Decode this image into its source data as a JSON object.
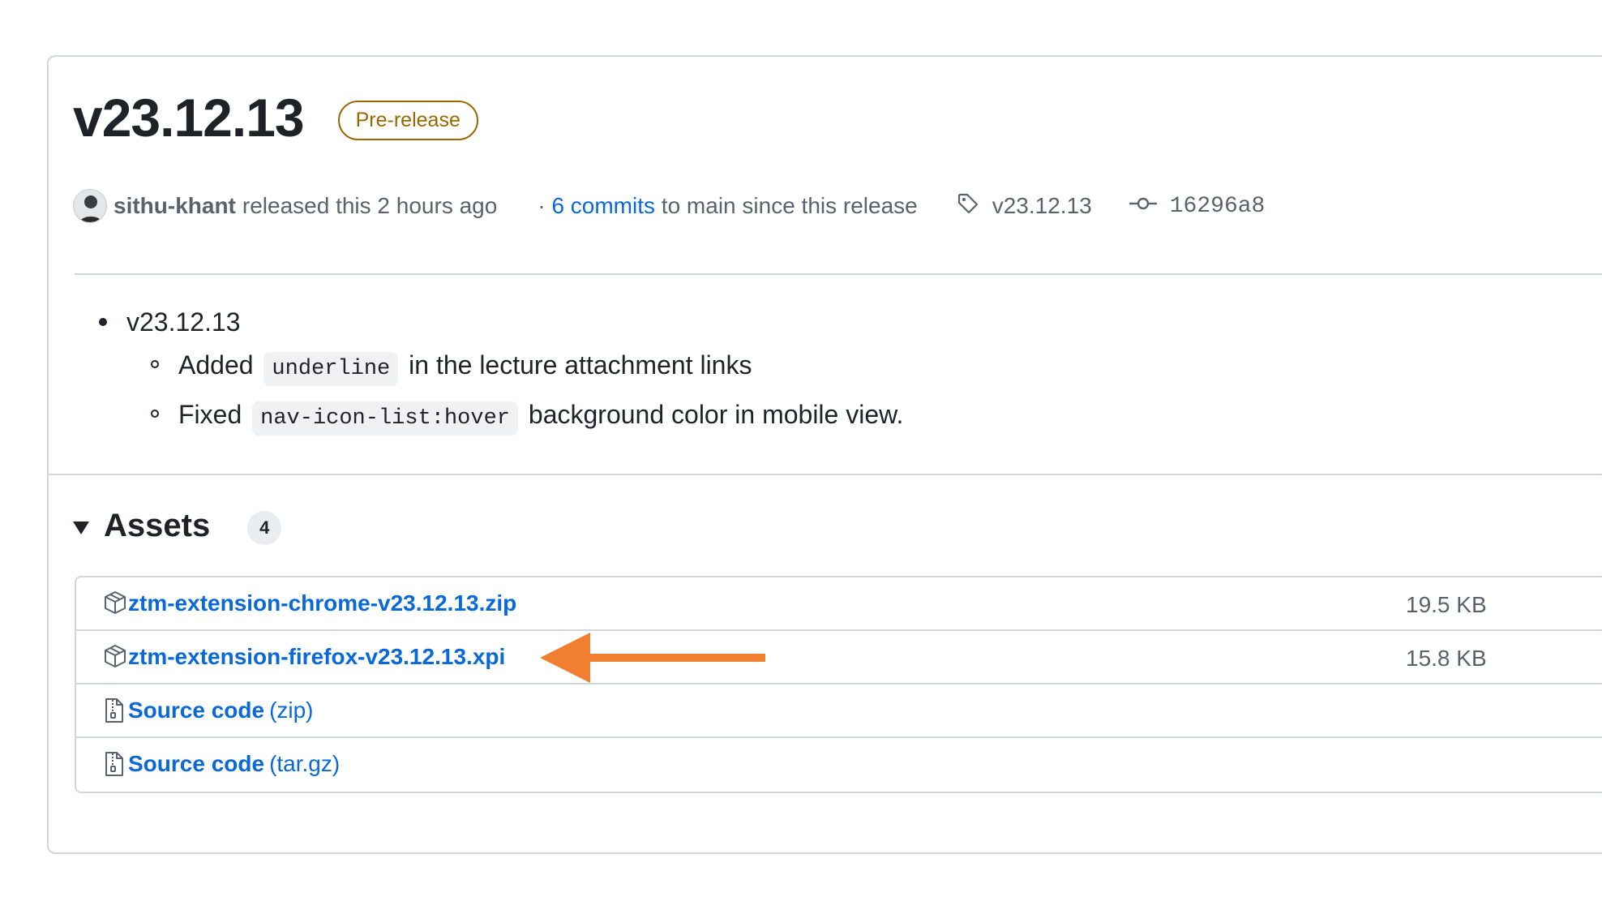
{
  "release": {
    "title": "v23.12.13",
    "badge": "Pre-release",
    "author": "sithu-khant",
    "released_text": "released this 2 hours ago",
    "commits_prefix": "·",
    "commits_link": "6 commits",
    "commits_suffix": "to main since this release",
    "tag": "v23.12.13",
    "commit_sha": "16296a8"
  },
  "notes": {
    "version": "v23.12.13",
    "items": [
      {
        "before": "Added",
        "code": "underline",
        "after": "in the lecture attachment links"
      },
      {
        "before": "Fixed",
        "code": "nav-icon-list:hover",
        "after": "background color in mobile view."
      }
    ]
  },
  "assets": {
    "title": "Assets",
    "count": "4",
    "files": [
      {
        "name": "ztm-extension-chrome-v23.12.13.zip",
        "size": "19.5 KB"
      },
      {
        "name": "ztm-extension-firefox-v23.12.13.xpi",
        "size": "15.8 KB"
      }
    ],
    "source": [
      {
        "name": "Source code",
        "ext": "(zip)"
      },
      {
        "name": "Source code",
        "ext": "(tar.gz)"
      }
    ]
  },
  "colors": {
    "link": "#0969da",
    "prerelease": "#9a6700",
    "annotation_arrow": "#f07f2f"
  },
  "icons": [
    "tag-icon",
    "git-commit-icon",
    "package-icon",
    "file-zip-icon",
    "triangle-down-icon"
  ]
}
